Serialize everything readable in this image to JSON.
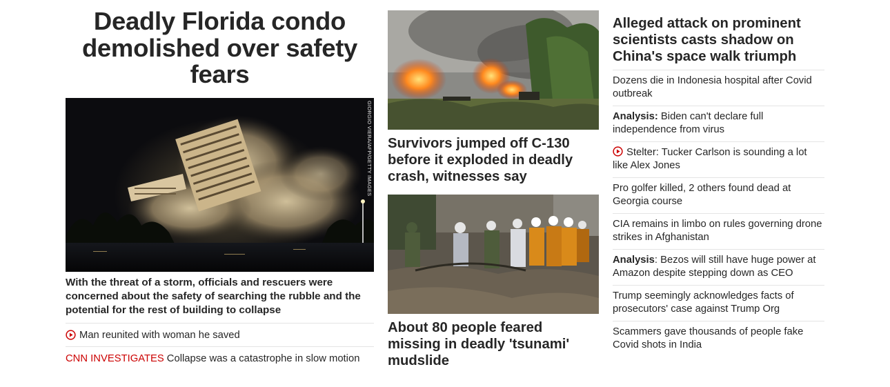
{
  "lead": {
    "headline": "Deadly Florida condo demolished over safety fears",
    "image_credit": "Giorgio Viera/AFP/Getty Images",
    "summary": "With the threat of a storm, officials and rescuers were concerned about the safety of searching the rubble and the potential for the rest of building to collapse",
    "related": [
      {
        "kicker": "",
        "text": "Man reunited with woman he saved",
        "icon": "play-icon"
      },
      {
        "kicker": "CNN INVESTIGATES",
        "text": "Collapse was a catastrophe in slow motion",
        "icon": ""
      }
    ]
  },
  "middle": {
    "stories": [
      {
        "headline": "Survivors jumped off C-130 before it exploded in deadly crash, witnesses say",
        "image": "plane-crash-fire-photo"
      },
      {
        "headline": "About 80 people feared missing in deadly 'tsunami' mudslide",
        "image": "mudslide-rescuers-photo"
      }
    ]
  },
  "right": {
    "headline": "Alleged attack on prominent scientists casts shadow on China's space walk triumph",
    "items": [
      {
        "prefix": "",
        "text": "Dozens die in Indonesia hospital after Covid outbreak",
        "icon": ""
      },
      {
        "prefix": "Analysis:",
        "text": " Biden can't declare full independence from virus",
        "icon": ""
      },
      {
        "prefix": "",
        "text": "Stelter: Tucker Carlson is sounding a lot like Alex Jones",
        "icon": "play-icon"
      },
      {
        "prefix": "",
        "text": "Pro golfer killed, 2 others found dead at Georgia course",
        "icon": ""
      },
      {
        "prefix": "",
        "text": "CIA remains in limbo on rules governing drone strikes in Afghanistan",
        "icon": ""
      },
      {
        "prefix": "Analysis",
        "text": ": Bezos will still have huge power at Amazon despite stepping down as CEO",
        "icon": ""
      },
      {
        "prefix": "",
        "text": "Trump seemingly acknowledges facts of prosecutors' case against Trump Org",
        "icon": ""
      },
      {
        "prefix": "",
        "text": "Scammers gave thousands of people fake Covid shots in India",
        "icon": ""
      }
    ]
  },
  "colors": {
    "text": "#262626",
    "brand_red": "#cc0000",
    "divider": "#e4e4e4"
  }
}
